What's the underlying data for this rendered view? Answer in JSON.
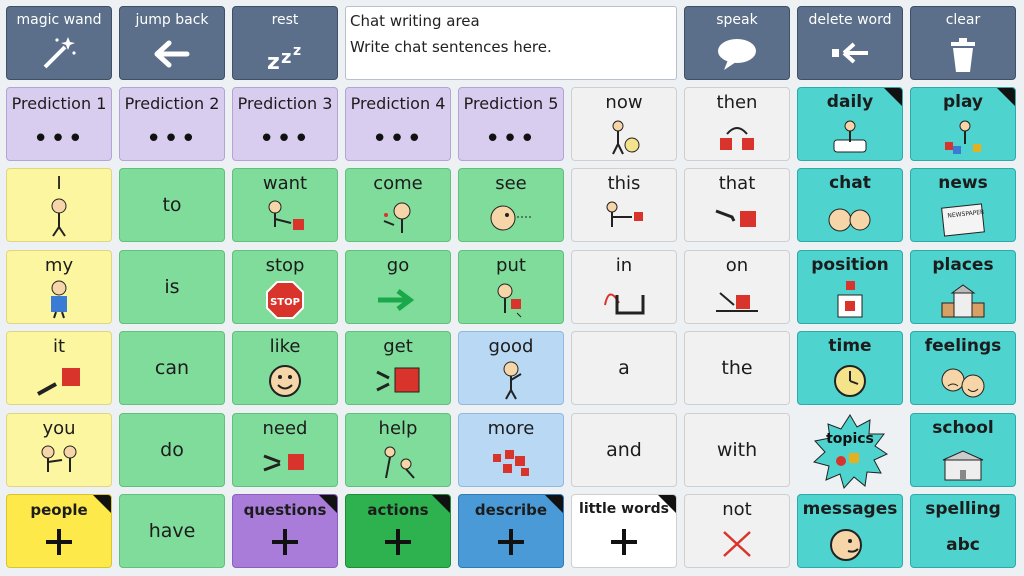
{
  "toolbar": {
    "magic_wand": "magic wand",
    "jump_back": "jump back",
    "rest": "rest",
    "speak": "speak",
    "delete_word": "delete word",
    "clear": "clear"
  },
  "chat_area": {
    "title": "Chat writing area",
    "placeholder": "Write chat sentences here."
  },
  "predictions": [
    "Prediction 1",
    "Prediction 2",
    "Prediction 3",
    "Prediction 4",
    "Prediction 5"
  ],
  "words": {
    "now": "now",
    "then": "then",
    "I": "I",
    "to": "to",
    "want": "want",
    "come": "come",
    "see": "see",
    "this": "this",
    "that": "that",
    "my": "my",
    "is": "is",
    "stop": "stop",
    "go": "go",
    "put": "put",
    "in": "in",
    "on": "on",
    "it": "it",
    "can": "can",
    "like": "like",
    "get": "get",
    "good": "good",
    "a": "a",
    "the": "the",
    "you": "you",
    "do": "do",
    "need": "need",
    "help": "help",
    "more": "more",
    "and": "and",
    "with": "with",
    "have": "have",
    "not": "not"
  },
  "stop_sign_text": "STOP",
  "topics": {
    "daily": "daily",
    "play": "play",
    "chat": "chat",
    "news": "news",
    "newspaper_text": "NEWSPAPER",
    "position": "position",
    "places": "places",
    "time": "time",
    "feelings": "feelings",
    "topics": "topics",
    "school": "school",
    "messages": "messages",
    "spelling": "spelling",
    "spelling_sub": "abc"
  },
  "categories": {
    "people": "people",
    "questions": "questions",
    "actions": "actions",
    "describe": "describe",
    "little_words": "little words"
  },
  "colors": {
    "toolbar": "#5b6f8a",
    "prediction": "#d9cdef",
    "pronoun": "#fdf6a0",
    "verb": "#7fdc9a",
    "little_word": "#f1f1f1",
    "describe": "#b8d8f4",
    "topic": "#4ed3cf",
    "symbol_red": "#d9342b"
  },
  "icons": {
    "magic_wand": "magic-wand-icon",
    "jump_back": "arrow-left-icon",
    "rest": "zzz-icon",
    "speak": "speech-bubble-icon",
    "delete_word": "delete-word-icon",
    "clear": "trash-icon"
  }
}
